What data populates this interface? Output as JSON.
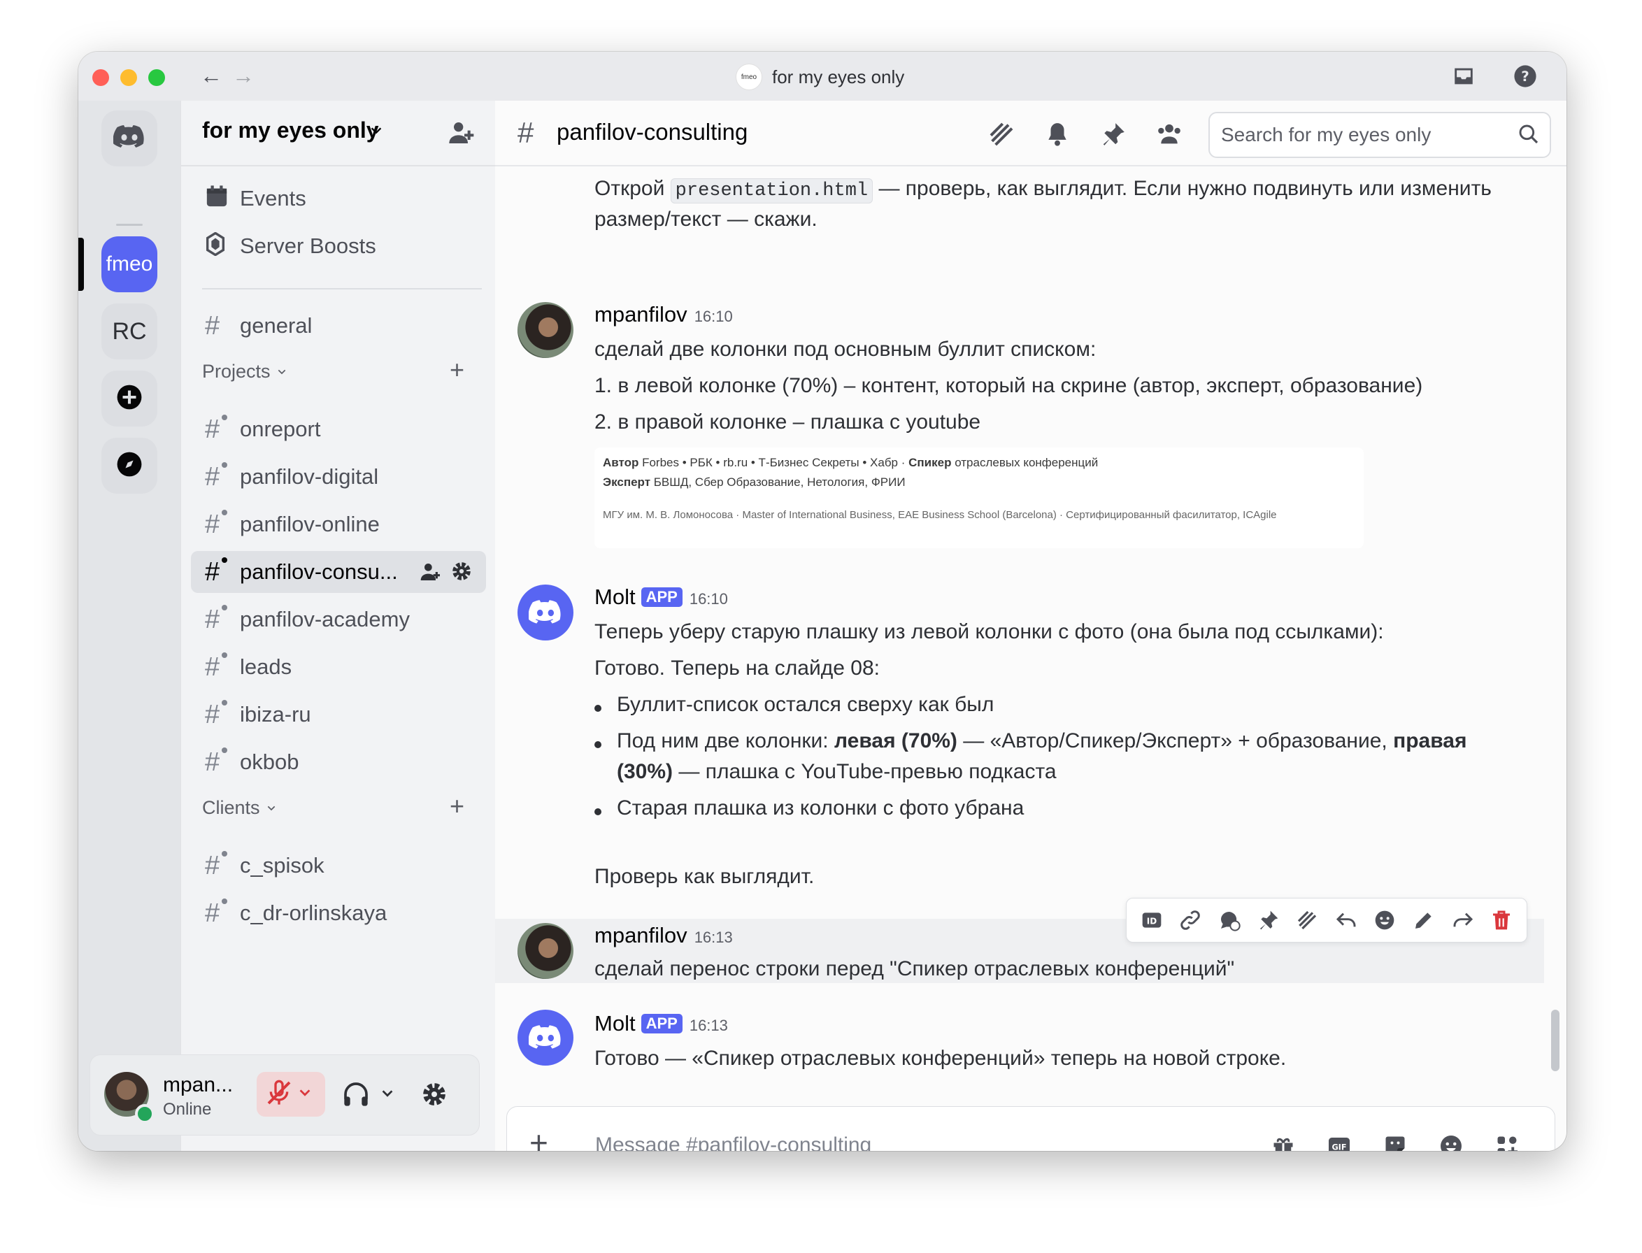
{
  "window": {
    "title": "for my eyes only",
    "title_icon_text": "fmeo"
  },
  "servers": {
    "items": [
      {
        "label": "fmeo",
        "icon": "discord-home-icon"
      },
      {
        "label": "RC"
      }
    ]
  },
  "sidebar": {
    "server_name": "for my eyes only",
    "top_items": [
      {
        "label": "Events",
        "icon": "calendar-icon"
      },
      {
        "label": "Server Boosts",
        "icon": "boost-icon"
      }
    ],
    "general": "general",
    "categories": [
      {
        "label": "Projects",
        "channels": [
          "onreport",
          "panfilov-digital",
          "panfilov-online",
          "panfilov-consu...",
          "panfilov-academy",
          "leads",
          "ibiza-ru",
          "okbob"
        ]
      },
      {
        "label": "Clients",
        "channels": [
          "c_spisok",
          "c_dr-orlinskaya"
        ]
      }
    ],
    "active_channel": "panfilov-consu..."
  },
  "user": {
    "name": "mpan...",
    "status": "Online"
  },
  "header": {
    "channel": "panfilov-consulting",
    "search_placeholder": "Search for my eyes only"
  },
  "messages": {
    "m0": {
      "line1_pre": "Открой ",
      "line1_code": "presentation.html",
      "line1_post": " — проверь, как выглядит. Если нужно подвинуть или изменить",
      "line2": "размер/текст — скажи."
    },
    "m1": {
      "author": "mpanfilov",
      "time": "16:10",
      "line1": "сделай две колонки под основным буллит списком:",
      "line2": "1. в левой колонке (70%) – контент, который на скрине (автор, эксперт, образование)",
      "line3": "2. в правой колонке – плашка с youtube",
      "embed": {
        "r1_b1": "Автор",
        "r1_t1": " Forbes • РБК • rb.ru • Т-Бизнес Секреты • Хабр · ",
        "r1_b2": "Спикер",
        "r1_t2": " отраслевых конференций",
        "r2_b1": "Эксперт",
        "r2_t1": " БВШД, Сбер Образование, Нетология, ФРИИ",
        "r3": "МГУ им. М. В. Ломоносова · Master of International Business, EAE Business School (Barcelona) · Сертифицированный фасилитатор, ICAgile"
      }
    },
    "m2": {
      "author": "Molt",
      "badge": "APP",
      "time": "16:10",
      "line1": "Теперь уберу старую плашку из левой колонки с фото (она была под ссылками):",
      "line2": "Готово. Теперь на слайде 08:",
      "b1": "Буллит-список остался сверху как был",
      "b2_pre": "Под ним две колонки: ",
      "b2_bold1": "левая (70%)",
      "b2_mid": " — «Автор/Спикер/Эксперт» + образование, ",
      "b2_bold2": "правая",
      "b2_bold3": "(30%)",
      "b2_post": " — плашка с YouTube-превью подкаста",
      "b3": "Старая плашка из колонки с фото убрана",
      "line_end": "Проверь как выглядит."
    },
    "m3": {
      "author": "mpanfilov",
      "time": "16:13",
      "line1": "сделай перенос строки перед \"Спикер отраслевых конференций\""
    },
    "m4": {
      "author": "Molt",
      "badge": "APP",
      "time": "16:13",
      "line1": "Готово — «Спикер отраслевых конференций» теперь на новой строке."
    }
  },
  "composer": {
    "placeholder": "Message #panfilov-consulting",
    "gif_label": "GIF"
  }
}
